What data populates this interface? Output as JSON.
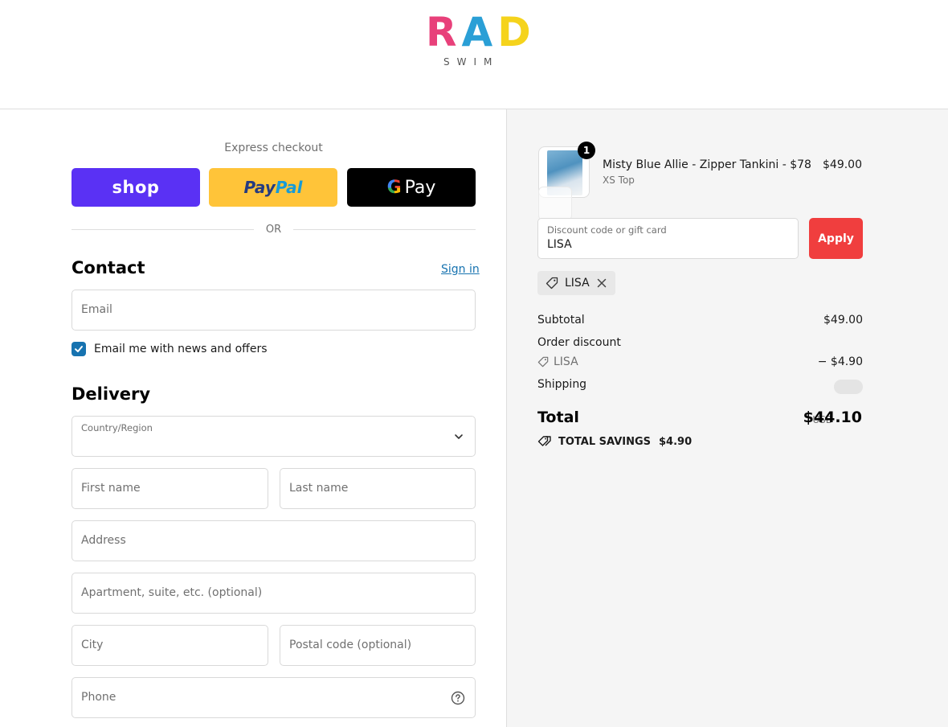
{
  "brand": {
    "letters": [
      {
        "char": "R",
        "color": "#e8407a"
      },
      {
        "char": "A",
        "color": "#2a9fd6"
      },
      {
        "char": "D",
        "color": "#f5d31c"
      }
    ],
    "subtitle": "SWIM",
    "colors": {
      "red_accent": "#f03e3e",
      "link": "#1773b0"
    }
  },
  "express": {
    "title": "Express checkout",
    "shop_label": "shop",
    "paypal_label_1": "Pay",
    "paypal_label_2": "Pal",
    "gpay_g": "G",
    "gpay_label": "Pay",
    "or_label": "OR"
  },
  "contact": {
    "title": "Contact",
    "signin_label": "Sign in",
    "email_placeholder": "Email",
    "newsletter_label": "Email me with news and offers",
    "newsletter_checked": true
  },
  "delivery": {
    "title": "Delivery",
    "country_label": "Country/Region",
    "country_value": "",
    "first_name_placeholder": "First name",
    "last_name_placeholder": "Last name",
    "address_placeholder": "Address",
    "apartment_placeholder": "Apartment, suite, etc. (optional)",
    "city_placeholder": "City",
    "postal_placeholder": "Postal code (optional)",
    "phone_placeholder": "Phone"
  },
  "order": {
    "product": {
      "name": "Misty Blue Allie - Zipper Tankini - $78",
      "variant": "XS Top",
      "price": "$49.00",
      "quantity": "1"
    },
    "discount": {
      "label": "Discount code or gift card",
      "value": "LISA",
      "apply_label": "Apply",
      "applied_code": "LISA"
    },
    "summary": {
      "subtotal_label": "Subtotal",
      "subtotal_value": "$49.00",
      "order_discount_label": "Order discount",
      "discount_code": "LISA",
      "discount_value": "− $4.90",
      "shipping_label": "Shipping",
      "total_label": "Total",
      "total_currency": "USD",
      "total_value": "$44.10",
      "savings_label": "TOTAL SAVINGS",
      "savings_value": "$4.90"
    }
  }
}
